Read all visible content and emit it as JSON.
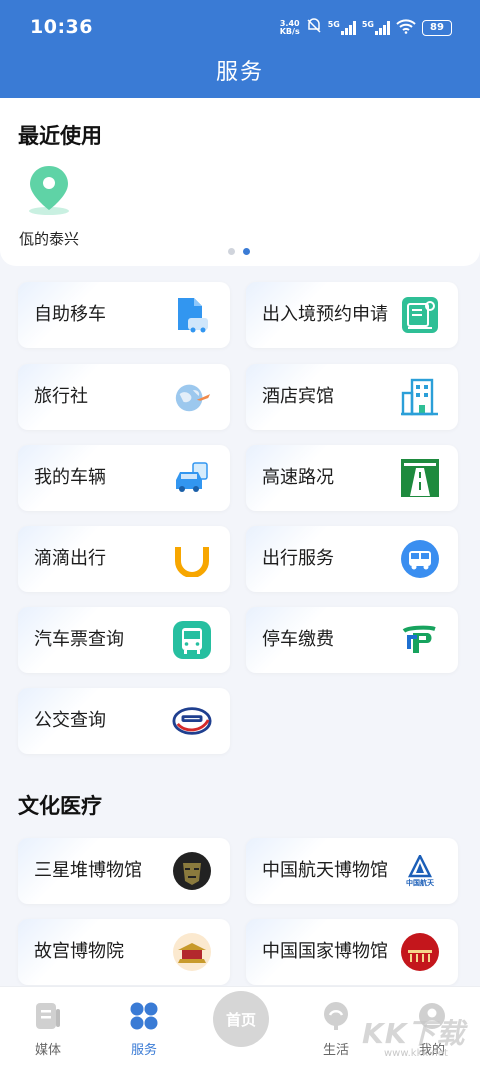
{
  "status_bar": {
    "time": "10:36",
    "speed_value": "3.40",
    "speed_unit": "KB/s",
    "network1": "5G",
    "network2": "5G",
    "battery": "89"
  },
  "header": {
    "title": "服务"
  },
  "recent": {
    "title": "最近使用",
    "items": [
      {
        "label": "佤的泰兴",
        "icon": "location-pin-icon"
      }
    ]
  },
  "transport_services": [
    {
      "label": "自助移车",
      "icon": "document-car-icon"
    },
    {
      "label": "出入境预约申请",
      "icon": "certificate-icon"
    },
    {
      "label": "旅行社",
      "icon": "globe-plane-icon"
    },
    {
      "label": "酒店宾馆",
      "icon": "building-icon"
    },
    {
      "label": "我的车辆",
      "icon": "car-document-icon"
    },
    {
      "label": "高速路况",
      "icon": "highway-icon"
    },
    {
      "label": "滴滴出行",
      "icon": "didi-logo-icon"
    },
    {
      "label": "出行服务",
      "icon": "bus-circle-icon"
    },
    {
      "label": "汽车票查询",
      "icon": "bus-icon"
    },
    {
      "label": "停车缴费",
      "icon": "parking-logo-icon"
    },
    {
      "label": "公交查询",
      "icon": "transit-logo-icon"
    }
  ],
  "culture": {
    "title": "文化医疗",
    "items": [
      {
        "label": "三星堆博物馆",
        "icon": "bronze-mask-icon"
      },
      {
        "label": "中国航天博物馆",
        "icon": "aerospace-logo-icon",
        "logo_text": "中国航天"
      },
      {
        "label": "故宫博物院",
        "icon": "palace-icon"
      },
      {
        "label": "中国国家博物馆",
        "icon": "national-museum-logo-icon"
      }
    ]
  },
  "bottom_nav": [
    {
      "label": "媒体",
      "icon": "media-icon",
      "active": false
    },
    {
      "label": "服务",
      "icon": "services-grid-icon",
      "active": true
    },
    {
      "label": "首页",
      "icon": "home-icon",
      "active": false
    },
    {
      "label": "生活",
      "icon": "life-icon",
      "active": false
    },
    {
      "label": "我的",
      "icon": "profile-icon",
      "active": false
    }
  ],
  "watermark": {
    "text": "KK下载",
    "url": "www.kkx.net"
  },
  "colors": {
    "primary": "#3a7bd5",
    "background": "#f3f5fa",
    "didi_orange": "#f7a600",
    "teal": "#26bfa0"
  }
}
